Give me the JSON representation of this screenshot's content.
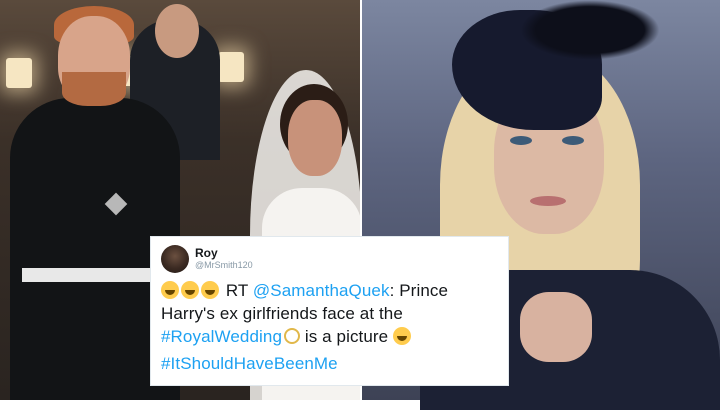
{
  "tweet": {
    "display_name": "Roy",
    "handle": "@MrSmith120",
    "prefix": "RT",
    "mention": "@SamanthaQuek",
    "text_1": ": Prince Harry's ex girlfriends face at the ",
    "hashtag_1": "#RoyalWedding",
    "text_2": " is a picture",
    "hashtag_2": "#ItShouldHaveBeenMe",
    "emoji_names": [
      "rofl-emoji",
      "rofl-emoji",
      "rofl-emoji",
      "rings-emoji",
      "joy-emoji"
    ]
  },
  "colors": {
    "link": "#1da1f2",
    "text": "#14171a",
    "handle": "#8899a6"
  }
}
